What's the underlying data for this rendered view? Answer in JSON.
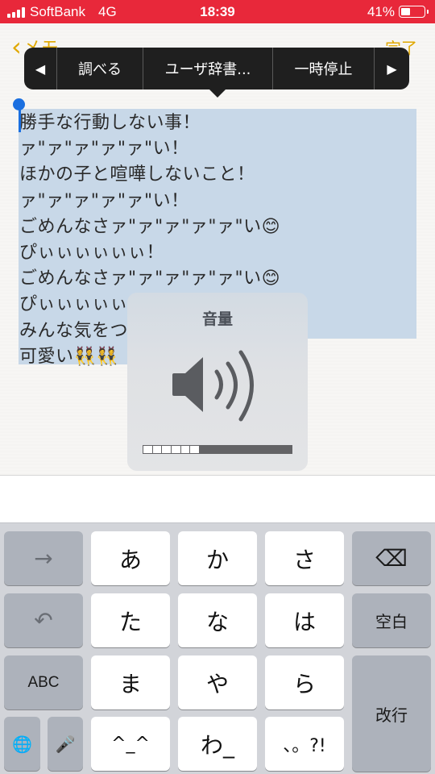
{
  "status_bar": {
    "carrier": "SoftBank",
    "network": "4G",
    "time": "18:39",
    "battery_percent": "41%",
    "battery_level": 0.41,
    "signal_bars": 4,
    "background_color": "#e8283a"
  },
  "nav": {
    "back_label": "メモ",
    "done_label": "完了",
    "accent_color": "#e0a800"
  },
  "edit_menu": {
    "prev_icon": "◀",
    "next_icon": "▶",
    "items": [
      "調べる",
      "ユーザ辞書...",
      "一時停止"
    ]
  },
  "note": {
    "lines": [
      "勝手な行動しない事！",
      "ァ\"ァ\"ァ\"ァ\"ァ\"い！",
      "ほかの子と喧嘩しないこと！",
      "ァ\"ァ\"ァ\"ァ\"ァ\"い！",
      "ごめんなさァ\"ァ\"ァ\"ァ\"ァ\"い😊",
      "ぴぃぃぃぃぃぃ！",
      "ごめんなさァ\"ァ\"ァ\"ァ\"ァ\"い😊",
      "ぴぃぃぃぃぃ",
      "みんな気をつ",
      "可愛い👯👯"
    ],
    "selection_color": "#c8d8e8"
  },
  "volume_hud": {
    "title": "音量",
    "icon": "speaker-icon",
    "level_steps": 6,
    "total_steps": 16
  },
  "keyboard": {
    "rows": [
      [
        {
          "label": "→",
          "name": "next-candidate-key",
          "style": "dark"
        },
        {
          "label": "あ",
          "name": "key-a",
          "style": "light"
        },
        {
          "label": "か",
          "name": "key-ka",
          "style": "light"
        },
        {
          "label": "さ",
          "name": "key-sa",
          "style": "light"
        },
        {
          "label": "⌫",
          "name": "delete-key",
          "style": "dark"
        }
      ],
      [
        {
          "label": "↶",
          "name": "undo-key",
          "style": "dark"
        },
        {
          "label": "た",
          "name": "key-ta",
          "style": "light"
        },
        {
          "label": "な",
          "name": "key-na",
          "style": "light"
        },
        {
          "label": "は",
          "name": "key-ha",
          "style": "light"
        },
        {
          "label": "空白",
          "name": "space-key",
          "style": "dark"
        }
      ],
      [
        {
          "label": "ABC",
          "name": "abc-key",
          "style": "dark"
        },
        {
          "label": "ま",
          "name": "key-ma",
          "style": "light"
        },
        {
          "label": "や",
          "name": "key-ya",
          "style": "light"
        },
        {
          "label": "ら",
          "name": "key-ra",
          "style": "light"
        },
        {
          "label": "改行",
          "name": "return-key",
          "style": "dark"
        }
      ],
      [
        {
          "label": "🌐",
          "name": "globe-key",
          "style": "dark"
        },
        {
          "label": "🎤",
          "name": "mic-key",
          "style": "dark"
        },
        {
          "label": "^_^",
          "name": "emoticon-key",
          "style": "light"
        },
        {
          "label": "わ_",
          "name": "key-wa",
          "style": "light"
        },
        {
          "label": "、。?!",
          "name": "punctuation-key",
          "style": "light"
        }
      ]
    ]
  }
}
